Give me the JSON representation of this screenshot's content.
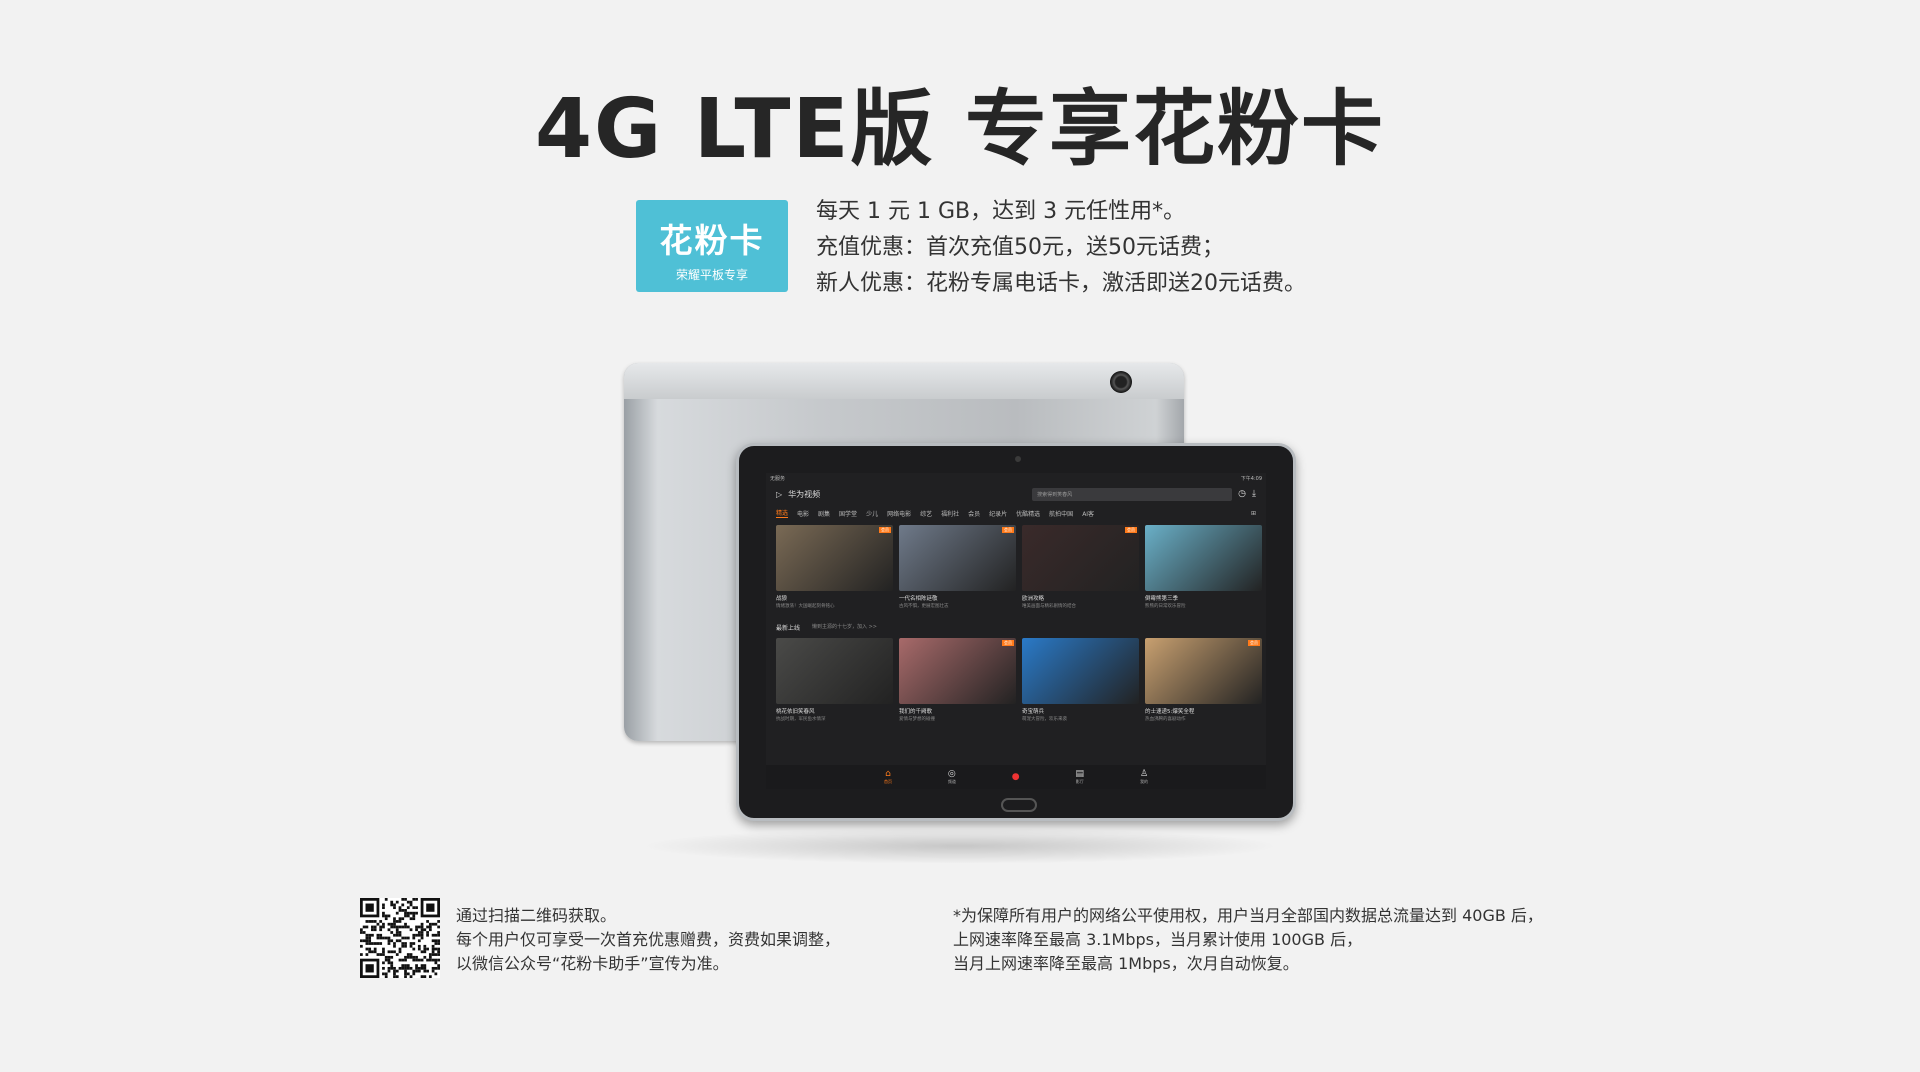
{
  "headline": "4G LTE版 专享花粉卡",
  "badge": {
    "main": "花粉卡",
    "sub": "荣耀平板专享",
    "color": "#4fc0d6"
  },
  "offer_lines": [
    "每天 1 元 1 GB，达到 3 元任性用*。",
    "充值优惠：首次充值50元，送50元话费；",
    "新人优惠：花粉专属电话卡，激活即送20元话费。"
  ],
  "tablet_screen": {
    "status_left": "无服务",
    "status_right": "下午4:09",
    "app_name": "华为视频",
    "search_placeholder": "搜索得到笑春风",
    "categories": [
      "精选",
      "电影",
      "剧集",
      "国学堂",
      "少儿",
      "网络电影",
      "综艺",
      "福利社",
      "会员",
      "纪录片",
      "优酷精选",
      "航拍中国",
      "AI客"
    ],
    "active_category": "精选",
    "row1": [
      {
        "title": "战狼",
        "sub": "情绪激荡！大国崛起刻骨铭心",
        "tag": "会员",
        "color": "#7a6a55"
      },
      {
        "title": "一代名相陈廷敬",
        "sub": "古风不惧，更展宏图壮志",
        "tag": "会员",
        "color": "#6f7a8a"
      },
      {
        "title": "欧洲攻略",
        "sub": "唯美画面与精彩剧情的结合",
        "tag": "会员",
        "color": "#3a2a2a"
      },
      {
        "title": "倒霉熊第三季",
        "sub": "熊熊的日常欢乐冒险",
        "tag": "",
        "color": "#6ab0c8"
      }
    ],
    "section_title": "最新上线",
    "section_sub": "懒到主源的十七岁，加入 >>",
    "row2": [
      {
        "title": "桃花依旧笑春风",
        "sub": "抗战时期，军民鱼水情深",
        "tag": "",
        "color": "#4a4a48"
      },
      {
        "title": "我们的千阙歌",
        "sub": "爱情与梦想的碰撞",
        "tag": "会员",
        "color": "#a86a6a"
      },
      {
        "title": "奇宝萌兵",
        "sub": "萌宠大冒险，欢乐来袭",
        "tag": "",
        "color": "#2a7ac8"
      },
      {
        "title": "的士速递5:爆笑全程",
        "sub": "热血沸腾的喜剧动作",
        "tag": "会员",
        "color": "#c8a070"
      }
    ],
    "nav": [
      "首页",
      "频道",
      "",
      "影厅",
      "我的"
    ]
  },
  "qr_text": [
    "通过扫描二维码获取。",
    "每个用户仅可享受一次首充优惠赠费，资费如果调整，",
    "以微信公众号“花粉卡助手”宣传为准。"
  ],
  "footnote": [
    "*为保障所有用户的网络公平使用权，用户当月全部国内数据总流量达到 40GB 后，",
    "上网速率降至最高 3.1Mbps，当月累计使用 100GB 后，",
    "当月上网速率降至最高 1Mbps，次月自动恢复。"
  ]
}
